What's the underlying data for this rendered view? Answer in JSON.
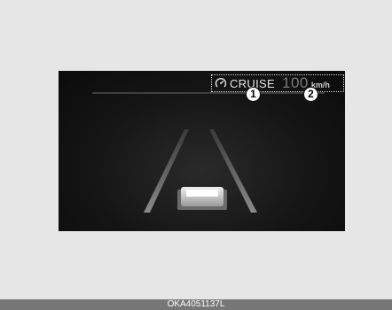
{
  "display": {
    "cruise_icon": "cruise-control-icon",
    "cruise_label": "CRUISE",
    "speed_value": "100",
    "speed_unit": "km/h"
  },
  "callouts": [
    "1",
    "2"
  ],
  "caption": "OKA4051137L",
  "colors": {
    "page_background": "#e6e6e6",
    "screen_background": "#111111",
    "caption_bar": "#777777"
  }
}
